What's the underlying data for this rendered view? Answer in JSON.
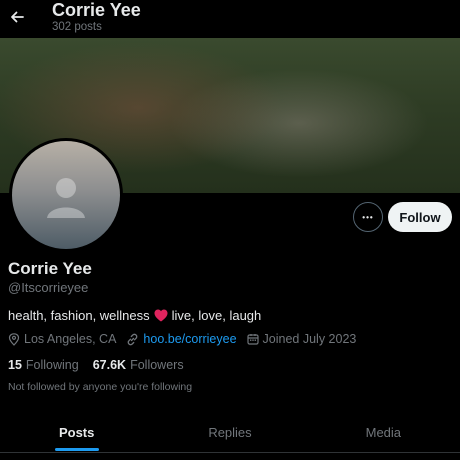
{
  "header": {
    "name": "Corrie Yee",
    "posts_count": "302 posts"
  },
  "profile": {
    "display_name": "Corrie Yee",
    "handle": "@Itscorrieyee",
    "bio_before": "health, fashion, wellness",
    "bio_after": "live, love, laugh",
    "location": "Los Angeles, CA",
    "link": "hoo.be/corrieyee",
    "joined": "Joined July 2023"
  },
  "actions": {
    "more_label": "•••",
    "follow_label": "Follow"
  },
  "stats": {
    "following_count": "15",
    "following_label": "Following",
    "followers_count": "67.6K",
    "followers_label": "Followers"
  },
  "social_context": "Not followed by anyone you're following",
  "tabs": [
    {
      "label": "Posts",
      "active": true
    },
    {
      "label": "Replies",
      "active": false
    },
    {
      "label": "Media",
      "active": false
    }
  ],
  "colors": {
    "background": "#000000",
    "accent": "#1d9bf0",
    "muted": "#71767b",
    "text": "#e7e9ea"
  }
}
